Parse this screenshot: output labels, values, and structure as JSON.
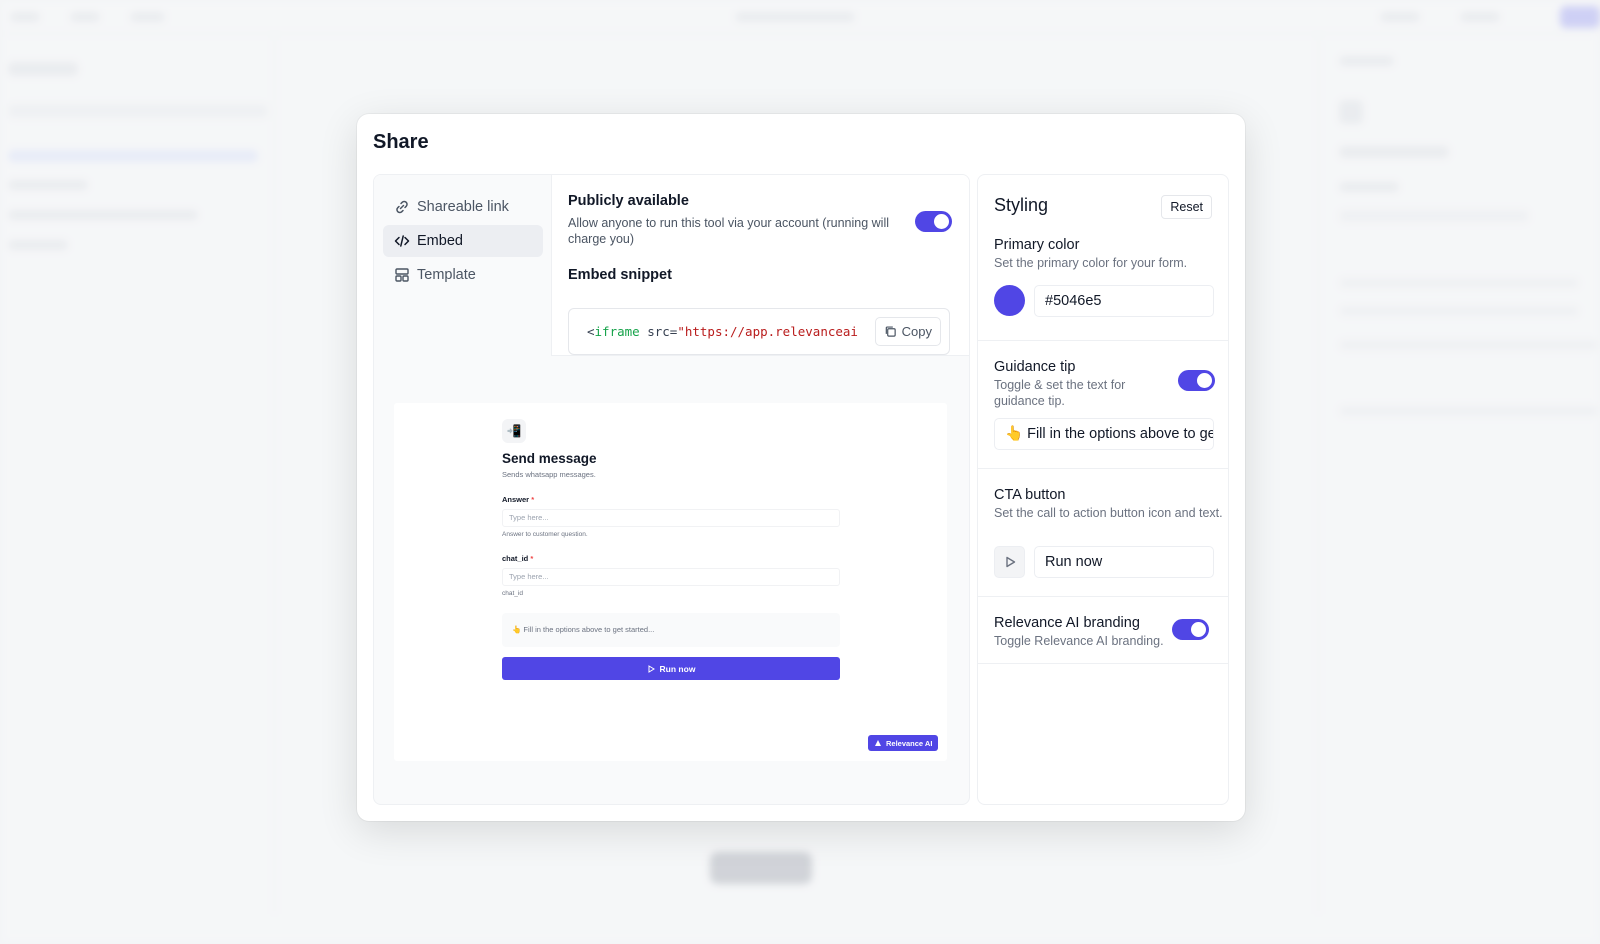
{
  "modal": {
    "title": "Share"
  },
  "tabs": [
    {
      "label": "Shareable link",
      "icon": "link-icon"
    },
    {
      "label": "Embed",
      "icon": "code-icon"
    },
    {
      "label": "Template",
      "icon": "template-icon"
    }
  ],
  "embed": {
    "public_label": "Publicly available",
    "public_desc": "Allow anyone to run this tool via your account (running will charge you)",
    "public_enabled": true,
    "snippet_label": "Embed snippet",
    "snippet_open": "<",
    "snippet_tag": "iframe",
    "snippet_attr": " src=",
    "snippet_value": "\"https://app.relevanceai",
    "copy_label": "Copy"
  },
  "preview": {
    "title": "Send message",
    "subtitle": "Sends whatsapp messages.",
    "fields": [
      {
        "label": "Answer",
        "required": "*",
        "placeholder": "Type here...",
        "help": "Answer to customer question."
      },
      {
        "label": "chat_id",
        "required": "*",
        "placeholder": "Type here...",
        "help": "chat_id"
      }
    ],
    "tip": "👆 Fill in the options above to get started...",
    "run_label": "Run now",
    "branding_label": "Relevance AI"
  },
  "styling": {
    "title": "Styling",
    "reset_label": "Reset",
    "primary_color": {
      "label": "Primary color",
      "desc": "Set the primary color for your form.",
      "value": "#5046e5"
    },
    "guidance_tip": {
      "label": "Guidance tip",
      "desc": "Toggle & set the text for guidance tip.",
      "value": "👆 Fill in the options above to get started...",
      "enabled": true
    },
    "cta_button": {
      "label": "CTA button",
      "desc": "Set the call to action button icon and text.",
      "icon": "play-icon",
      "value": "Run now"
    },
    "branding": {
      "label": "Relevance AI branding",
      "desc": "Toggle Relevance AI branding.",
      "enabled": true
    }
  },
  "colors": {
    "accent": "#5046e5",
    "code_tag": "#16a34a",
    "code_string": "#b91c1c"
  }
}
